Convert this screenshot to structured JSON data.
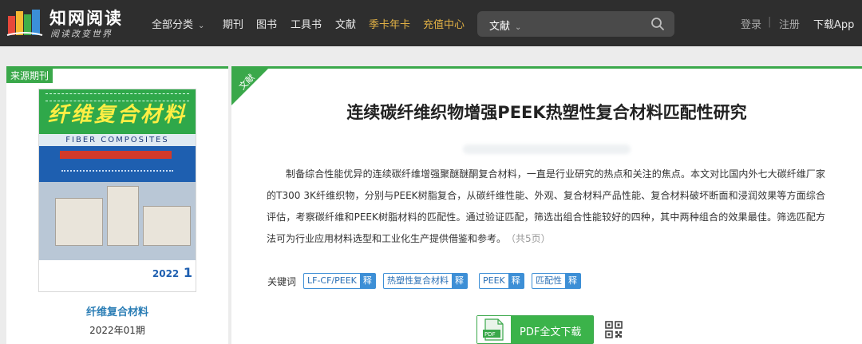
{
  "logo": {
    "title": "知网阅读",
    "slogan": "阅读改变世界"
  },
  "nav": {
    "items": [
      {
        "label": "全部分类",
        "has_dropdown": true
      },
      {
        "label": "期刊"
      },
      {
        "label": "图书"
      },
      {
        "label": "工具书"
      },
      {
        "label": "文献"
      },
      {
        "label": "季卡年卡",
        "highlight": true
      },
      {
        "label": "充值中心",
        "highlight": true
      }
    ],
    "search": {
      "category": "文献",
      "placeholder": "",
      "value": ""
    },
    "login": "登录",
    "separator": "|",
    "register": "注册",
    "download_app": "下载App"
  },
  "source": {
    "tag": "来源期刊",
    "cover": {
      "title": "纤维复合材料",
      "subtitle": "FIBER COMPOSITES",
      "year": "2022",
      "issue": "1"
    },
    "journal_name": "纤维复合材料",
    "issue_label": "2022年01期"
  },
  "article": {
    "corner_tag": "文献",
    "title": "连续碳纤维织物增强PEEK热塑性复合材料匹配性研究",
    "abstract": "制备综合性能优异的连续碳纤维增强聚醚醚酮复合材料，一直是行业研究的热点和关注的焦点。本文对比国内外七大碳纤维厂家的T300 3K纤维织物，分别与PEEK树脂复合，从碳纤维性能、外观、复合材料产品性能、复合材料破坏断面和浸润效果等方面综合评估，考察碳纤维和PEEK树脂材料的匹配性。通过验证匹配，筛选出组合性能较好的四种，其中两种组合的效果最佳。筛选匹配方法可为行业应用材料选型和工业化生产提供借鉴和参考。",
    "pages": "（共5页）",
    "keywords_label": "关键词",
    "keywords": [
      "LF-CF/PEEK",
      "热塑性复合材料",
      "PEEK",
      "匹配性"
    ],
    "keyword_action": "释",
    "pdf_button": "PDF全文下载",
    "pdf_icon_text": "PDF"
  },
  "colors": {
    "topbar": "#2e2e2e",
    "accent_green": "#3aa84a",
    "highlight_gold": "#e2b145",
    "keyword_blue": "#3d8fd6",
    "journal_link": "#2a7db5"
  }
}
